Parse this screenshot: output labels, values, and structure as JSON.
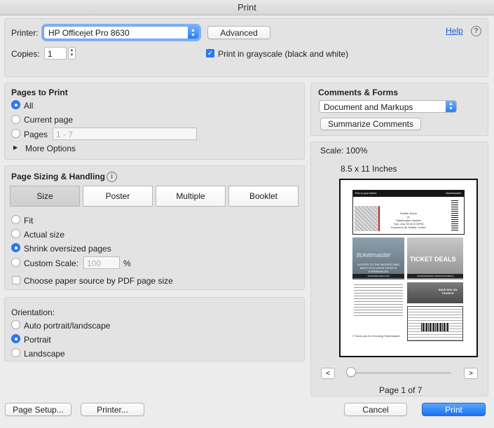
{
  "window": {
    "title": "Print"
  },
  "top": {
    "printer_label": "Printer:",
    "printer_value": "HP Officejet Pro 8630",
    "advanced_label": "Advanced",
    "help_label": "Help",
    "help_icon": "?",
    "copies_label": "Copies:",
    "copies_value": "1",
    "grayscale_label": "Print in grayscale (black and white)",
    "grayscale_checked": true
  },
  "pages_to_print": {
    "title": "Pages to Print",
    "all_label": "All",
    "current_label": "Current page",
    "pages_label": "Pages",
    "pages_placeholder": "1 - 7",
    "more_options_label": "More Options",
    "selected": "all"
  },
  "sizing": {
    "title": "Page Sizing & Handling",
    "info_icon": "i",
    "tabs": [
      "Size",
      "Poster",
      "Multiple",
      "Booklet"
    ],
    "active_tab": "Size",
    "options": [
      "Fit",
      "Actual size",
      "Shrink oversized pages",
      "Custom Scale:"
    ],
    "selected": "Shrink oversized pages",
    "custom_scale_placeholder": "100",
    "percent_sign": "%",
    "paper_source_label": "Choose paper source by PDF page size"
  },
  "orientation": {
    "title": "Orientation:",
    "options": [
      "Auto portrait/landscape",
      "Portrait",
      "Landscape"
    ],
    "selected": "Portrait"
  },
  "comments_forms": {
    "title": "Comments & Forms",
    "value": "Document and Markups",
    "summarize_label": "Summarize Comments"
  },
  "preview": {
    "scale_label": "Scale: 100%",
    "paper_size_label": "8.5 x 11 Inches",
    "prev_label": "<",
    "next_label": ">",
    "page_indicator": "Page 1 of 7",
    "slider_position": 0,
    "ticket": {
      "headline": "This is your ticket.",
      "brand": "ticketmaster",
      "event_line1": "Seattle Storm",
      "event_line2": "vs.",
      "event_line3": "Washington Mystics",
      "event_line4": "Sun, July 30 @ 6:00PM",
      "event_line5": "KeyArena @ Seattle Center",
      "ad1_brand": "ticketmaster",
      "ad1_text": "ACCESS TO THE BIGGEST AND MOST EXCLUSIVE SPORTS EXPERIENCES",
      "ad1_url": "TICKETMASTER.COM",
      "ad2_title": "TICKET DEALS",
      "ad2_url": "TICKETMASTER.COM/TICKETDEALS",
      "ad3_text": "SAVE 50% ON TICKETS",
      "footer_text": "Thank you for choosing Ticketmaster"
    }
  },
  "footer": {
    "page_setup_label": "Page Setup...",
    "printer_label": "Printer...",
    "cancel_label": "Cancel",
    "print_label": "Print"
  },
  "colors": {
    "accent": "#2b7cf0",
    "window_bg": "#ececec",
    "panel_bg": "#e3e3e3",
    "link": "#1b59d6"
  }
}
